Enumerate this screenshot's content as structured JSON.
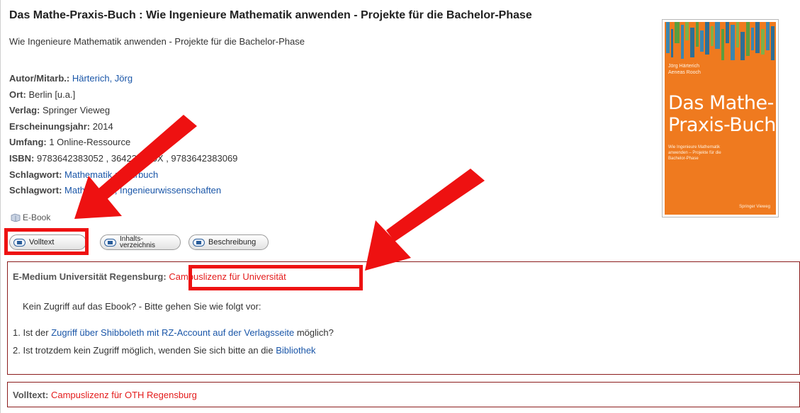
{
  "record": {
    "title": "Das Mathe-Praxis-Buch :  Wie Ingenieure Mathematik anwenden - Projekte für die Bachelor-Phase",
    "subtitle": "Wie Ingenieure Mathematik anwenden - Projekte für die Bachelor-Phase",
    "fields": [
      {
        "label": "Autor/Mitarb.:",
        "value": "Härterich, Jörg",
        "link": true
      },
      {
        "label": "Ort:",
        "value": "Berlin [u.a.]",
        "link": false
      },
      {
        "label": "Verlag:",
        "value": "Springer Vieweg",
        "link": false
      },
      {
        "label": "Erscheinungsjahr:",
        "value": "2014",
        "link": false
      },
      {
        "label": "Umfang:",
        "value": "1 Online-Ressource",
        "link": false
      },
      {
        "label": "ISBN:",
        "value": "9783642383052 , 364238305X , 9783642383069",
        "link": false
      },
      {
        "label": "Schlagwort:",
        "value": "Mathematik ; Lehrbuch",
        "link": true
      },
      {
        "label": "Schlagwort:",
        "value": "Mathematik ; Ingenieurwissenschaften",
        "link": true
      }
    ],
    "media_type": "E-Book",
    "media_icon": "ebook-icon"
  },
  "cover": {
    "authors_line1": "Jörg Härterich",
    "authors_line2": "Aeneas Rooch",
    "title_line1": "Das Mathe-",
    "title_line2": "Praxis-Buch",
    "subtitle_line1": "Wie Ingenieure Mathematik",
    "subtitle_line2": "anwenden – Projekte für die",
    "subtitle_line3": "Bachelor-Phase",
    "publisher": "Springer Vieweg",
    "color": "#ef7a1f"
  },
  "buttons": {
    "volltext": "Volltext",
    "inhalt_line1": "Inhalts-",
    "inhalt_line2": "verzeichnis",
    "beschreibung": "Beschreibung",
    "icon": "document-icon"
  },
  "access": {
    "emedium_label": "E-Medium Universität Regensburg:",
    "emedium_value": "Campuslizenz für Universität",
    "hint": "Kein Zugriff auf das Ebook? - Bitte gehen Sie wie folgt vor:",
    "step1_prefix": "1. Ist der",
    "step1_link": "Zugriff über Shibboleth mit RZ-Account auf der Verlagsseite",
    "step1_suffix": "möglich?",
    "step2_prefix": "2. Ist trotzdem kein Zugriff möglich, wenden Sie sich bitte an die",
    "step2_link": "Bibliothek",
    "volltext_label": "Volltext:",
    "volltext_value": "Campuslizenz für OTH Regensburg"
  },
  "colors": {
    "link": "#1a56a8",
    "license_red": "#e41b1b",
    "annotation_red": "#ee1111",
    "box_border": "#8b1c1c"
  }
}
